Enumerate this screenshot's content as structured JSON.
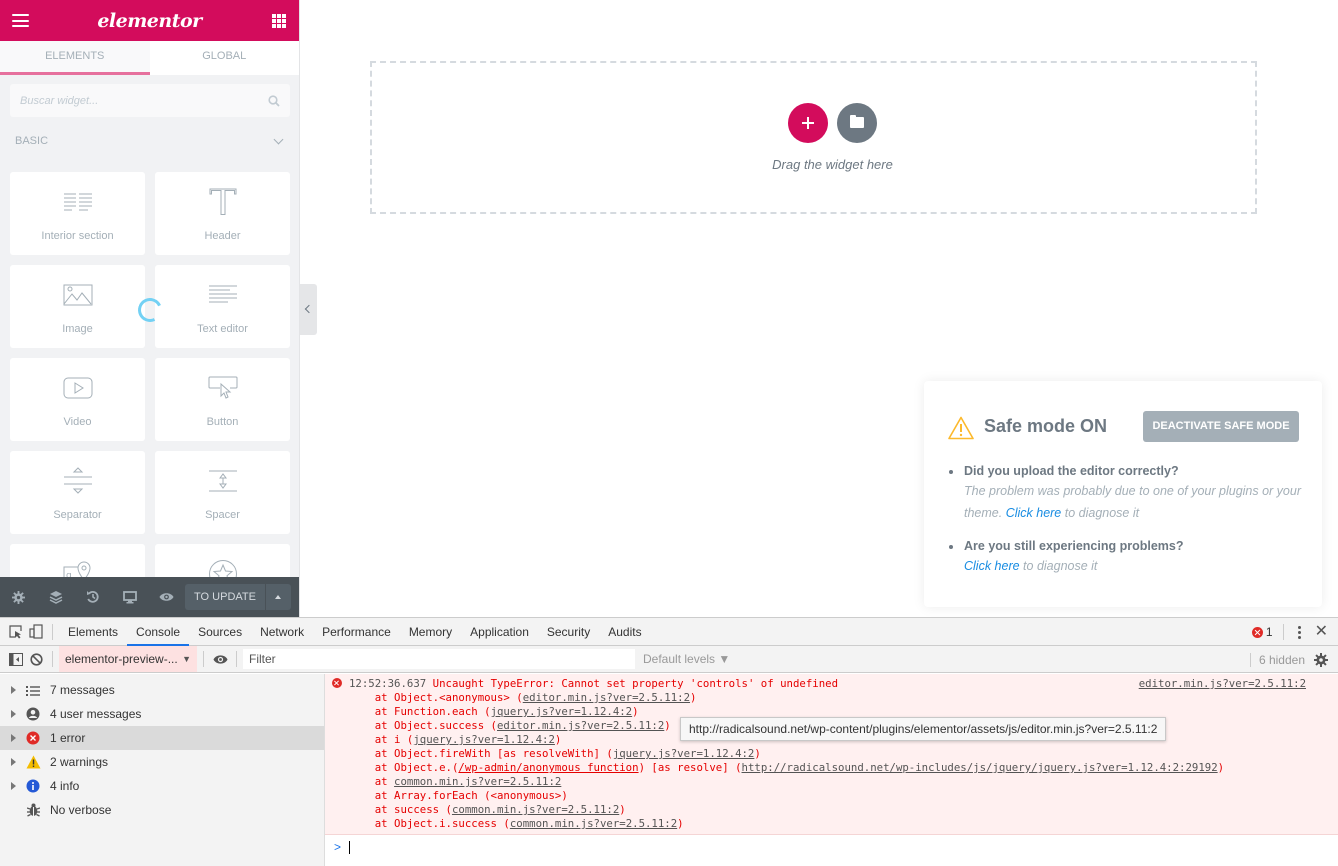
{
  "panel": {
    "logo": "elementor",
    "tabs": [
      "Elements",
      "Global"
    ],
    "active_tab": 0,
    "search_placeholder": "Buscar widget...",
    "category": "Basic",
    "widgets": [
      {
        "label": "Interior section",
        "icon": "inner-section-icon"
      },
      {
        "label": "Header",
        "icon": "heading-icon"
      },
      {
        "label": "Image",
        "icon": "image-icon"
      },
      {
        "label": "Text editor",
        "icon": "text-editor-icon"
      },
      {
        "label": "Video",
        "icon": "video-icon"
      },
      {
        "label": "Button",
        "icon": "button-icon"
      },
      {
        "label": "Separator",
        "icon": "separator-icon"
      },
      {
        "label": "Spacer",
        "icon": "spacer-icon"
      },
      {
        "label": "",
        "icon": "google-maps-icon"
      },
      {
        "label": "",
        "icon": "star-icon"
      }
    ],
    "footer": {
      "update_label": "To update",
      "icons": [
        "settings-icon",
        "navigator-icon",
        "history-icon",
        "responsive-icon",
        "preview-icon"
      ]
    }
  },
  "preview": {
    "drag_text": "Drag the widget here"
  },
  "safe_mode": {
    "title": "Safe mode ON",
    "button": "Deactivate safe mode",
    "items": [
      {
        "question": "Did you upload the editor correctly?",
        "answer_pre": "The problem was probably due to one of your plugins or your theme. ",
        "link": "Click here",
        "answer_post": " to diagnose it"
      },
      {
        "question": "Are you still experiencing problems?",
        "answer_pre": "",
        "link": "Click here",
        "answer_post": " to diagnose it"
      }
    ],
    "colors": {
      "accent": "#d30c5c",
      "link": "#1a8de2",
      "warning": "#fcb92c"
    }
  },
  "devtools": {
    "tabs": [
      "Elements",
      "Console",
      "Sources",
      "Network",
      "Performance",
      "Memory",
      "Application",
      "Security",
      "Audits"
    ],
    "active_tab": "Console",
    "error_count": "1",
    "context": "elementor-preview-...",
    "filter_placeholder": "Filter",
    "levels": "Default levels ▼",
    "hidden": "6 hidden",
    "sidebar": [
      {
        "label": "7 messages",
        "icon": "list-icon",
        "expandable": true
      },
      {
        "label": "4 user messages",
        "icon": "user-icon",
        "expandable": true
      },
      {
        "label": "1 error",
        "icon": "error-icon",
        "expandable": true,
        "selected": true
      },
      {
        "label": "2 warnings",
        "icon": "warning-icon",
        "expandable": true
      },
      {
        "label": "4 info",
        "icon": "info-icon",
        "expandable": true
      },
      {
        "label": "No verbose",
        "icon": "bug-icon",
        "expandable": false
      }
    ],
    "error": {
      "timestamp": "12:52:36.637",
      "message": "Uncaught TypeError: Cannot set property 'controls' of undefined",
      "source": "editor.min.js?ver=2.5.11:2",
      "stack": [
        {
          "pre": "    at Object.<anonymous> (",
          "link": "editor.min.js?ver=2.5.11:2",
          "post": ")"
        },
        {
          "pre": "    at Function.each (",
          "link": "jquery.js?ver=1.12.4:2",
          "post": ")"
        },
        {
          "pre": "    at Object.success (",
          "link": "editor.min.js?ver=2.5.11:2",
          "post": ")"
        },
        {
          "pre": "    at i (",
          "link": "jquery.js?ver=1.12.4:2",
          "post": ")"
        },
        {
          "pre": "    at Object.fireWith [as resolveWith] (",
          "link": "jquery.js?ver=1.12.4:2",
          "post": ")"
        },
        {
          "pre": "    at Object.e.(",
          "link": "/wp-admin/anonymous function",
          "post": ") [as resolve] (",
          "link2": "http://radicalsound.net/wp-includes/js/jquery/jquery.js?ver=1.12.4:2:29192",
          "post2": ")"
        },
        {
          "pre": "    at ",
          "link": "common.min.js?ver=2.5.11:2",
          "post": ""
        },
        {
          "pre": "    at Array.forEach (<anonymous>)",
          "link": "",
          "post": ""
        },
        {
          "pre": "    at success (",
          "link": "common.min.js?ver=2.5.11:2",
          "post": ")"
        },
        {
          "pre": "    at Object.i.success (",
          "link": "common.min.js?ver=2.5.11:2",
          "post": ")"
        }
      ]
    },
    "tooltip": "http://radicalsound.net/wp-content/plugins/elementor/assets/js/editor.min.js?ver=2.5.11:2",
    "prompt": ">"
  }
}
